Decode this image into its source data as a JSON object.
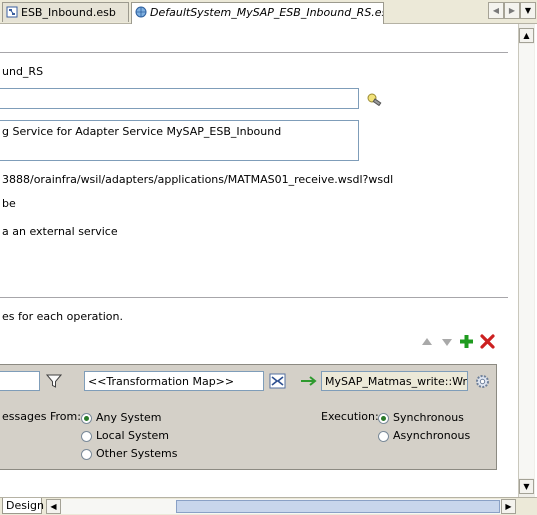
{
  "tabs": [
    {
      "label": "ESB_Inbound.esb",
      "active": false
    },
    {
      "label": "DefaultSystem_MySAP_ESB_Inbound_RS.esbsvc",
      "active": true
    }
  ],
  "form": {
    "name_value": "und_RS",
    "system_field_value": "",
    "description_value": "g Service for Adapter Service MySAP_ESB_Inbound",
    "wsdl_value": "3888/orainfra/wsil/adapters/applications/MATMAS01_receive.wsdl?wsdl",
    "type_value": "be",
    "external_label": "a an external service"
  },
  "operations_hint": "es for each operation.",
  "routing": {
    "filter_value": "",
    "transformation_map": "<<Transformation Map>>",
    "target": "MySAP_Matmas_write::Write",
    "accept_label": "essages From:",
    "accept_options": [
      "Any System",
      "Local System",
      "Other Systems"
    ],
    "accept_selected": "Any System",
    "execution_label": "Execution:",
    "execution_options": [
      "Synchronous",
      "Asynchronous"
    ],
    "execution_selected": "Synchronous"
  },
  "bottom_tab": "Design",
  "colors": {
    "add_icon": "#1f9b1f",
    "delete_icon": "#cc2020",
    "arrow_icon": "#2e9a2e"
  }
}
